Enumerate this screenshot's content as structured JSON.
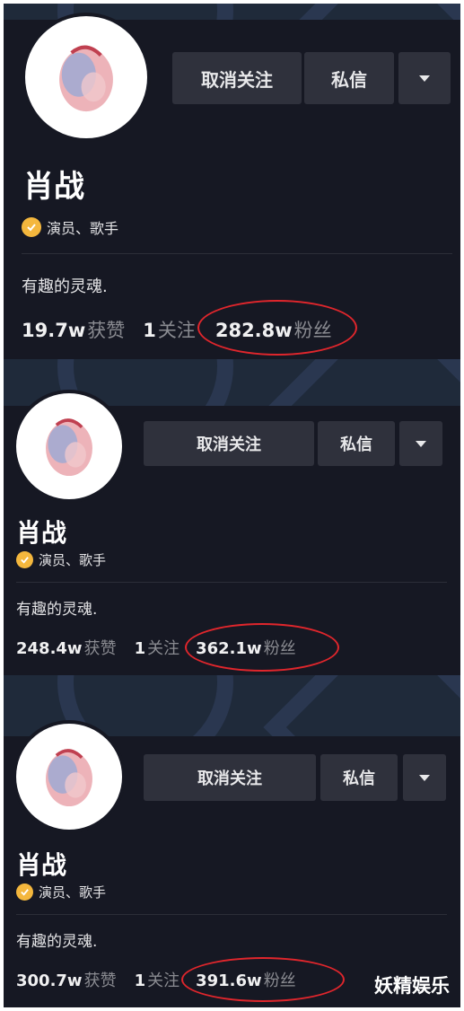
{
  "watermark": "妖精娱乐",
  "colors": {
    "background": "#161823",
    "button": "#2f313c",
    "verified_badge": "#f4b73d",
    "highlight_ring": "#e0262c"
  },
  "panels": [
    {
      "buttons": {
        "unfollow": "取消关注",
        "message": "私信",
        "more_icon": "chevron-down-icon"
      },
      "name": "肖战",
      "verified_tag": "演员、歌手",
      "bio": "有趣的灵魂.",
      "likes_value": "19.7w",
      "likes_label": "获赞",
      "following_value": "1",
      "following_label": "关注",
      "followers_value": "282.8w",
      "followers_label": "粉丝"
    },
    {
      "buttons": {
        "unfollow": "取消关注",
        "message": "私信",
        "more_icon": "chevron-down-icon"
      },
      "name": "肖战",
      "verified_tag": "演员、歌手",
      "bio": "有趣的灵魂.",
      "likes_value": "248.4w",
      "likes_label": "获赞",
      "following_value": "1",
      "following_label": "关注",
      "followers_value": "362.1w",
      "followers_label": "粉丝"
    },
    {
      "buttons": {
        "unfollow": "取消关注",
        "message": "私信",
        "more_icon": "chevron-down-icon"
      },
      "name": "肖战",
      "verified_tag": "演员、歌手",
      "bio": "有趣的灵魂.",
      "likes_value": "300.7w",
      "likes_label": "获赞",
      "following_value": "1",
      "following_label": "关注",
      "followers_value": "391.6w",
      "followers_label": "粉丝"
    }
  ]
}
